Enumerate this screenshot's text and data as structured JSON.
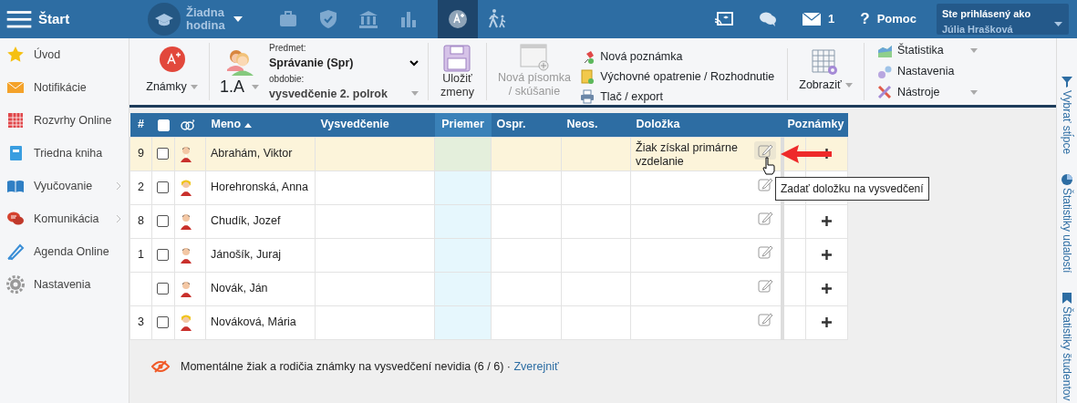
{
  "topbar": {
    "menu_label": "Štart",
    "lesson": "Žiadna hodina",
    "nav": [
      {
        "kind": "briefcase",
        "selected": false
      },
      {
        "kind": "shield",
        "selected": false
      },
      {
        "kind": "bank",
        "selected": false
      },
      {
        "kind": "chart",
        "selected": false
      },
      {
        "kind": "grade",
        "selected": true
      },
      {
        "kind": "walk",
        "selected": false
      }
    ],
    "mail_count": "1",
    "help_icon": "?",
    "help": "Pomoc",
    "user_label": "Ste prihlásený ako",
    "user_name": "Júlia Hrašková"
  },
  "sidebar": {
    "items": [
      {
        "label": "Úvod",
        "submenu": false
      },
      {
        "label": "Notifikácie",
        "submenu": false
      },
      {
        "label": "Rozvrhy Online",
        "submenu": false
      },
      {
        "label": "Triedna kniha",
        "submenu": false
      },
      {
        "label": "Vyučovanie",
        "submenu": true
      },
      {
        "label": "Komunikácia",
        "submenu": true
      },
      {
        "label": "Agenda Online",
        "submenu": false
      },
      {
        "label": "Nastavenia",
        "submenu": false
      }
    ]
  },
  "toolbar": {
    "grades": "Známky",
    "class": "1.A",
    "subject_label": "Predmet:",
    "subject": "Správanie (Spr)",
    "period_label": "obdobie:",
    "period": "vysvedčenie 2. polrok",
    "save": [
      "Uložiť",
      "zmeny"
    ],
    "new_test": {
      "lines": [
        "Nová písomka",
        "/ skúšanie"
      ],
      "disabled": true
    },
    "actions": [
      "Nová poznámka",
      "Výchovné opatrenie / Rozhodnutie",
      "Tlač / export"
    ],
    "view": "Zobraziť",
    "tools": [
      {
        "label": "Štatistika",
        "dropdown": true
      },
      {
        "label": "Nastavenia",
        "dropdown": false
      },
      {
        "label": "Nástroje",
        "dropdown": true
      }
    ]
  },
  "table": {
    "columns": [
      {
        "kind": "number",
        "label": "#"
      },
      {
        "kind": "select",
        "checked": false
      },
      {
        "kind": "gender"
      },
      {
        "kind": "name",
        "label": "Meno",
        "sorted": true
      },
      {
        "kind": "text",
        "label": "Vysvedčenie"
      },
      {
        "kind": "average",
        "label": "Priemer"
      },
      {
        "kind": "text",
        "label": "Ospr."
      },
      {
        "kind": "text",
        "label": "Neos."
      },
      {
        "kind": "clause",
        "label": "Doložka"
      },
      {
        "kind": "notes",
        "label": "Poznámky"
      }
    ],
    "rows": [
      {
        "number": "9",
        "checked": false,
        "kind": "boy",
        "name": "Abrahám, Viktor",
        "clause": "Žiak získal primárne vzdelanie",
        "highlighted": true
      },
      {
        "number": "2",
        "checked": false,
        "kind": "girl",
        "name": "Horehronská, Anna",
        "highlighted": false
      },
      {
        "number": "8",
        "checked": false,
        "kind": "boy",
        "name": "Chudík, Jozef",
        "highlighted": false
      },
      {
        "number": "1",
        "checked": false,
        "kind": "boy",
        "name": "Jánošík, Juraj",
        "highlighted": false
      },
      {
        "checked": false,
        "kind": "boy",
        "name": "Novák, Ján",
        "highlighted": false
      },
      {
        "number": "3",
        "checked": false,
        "kind": "girl",
        "name": "Nováková, Mária",
        "highlighted": false
      }
    ]
  },
  "tooltip": "Zadať doložku na vysvedčení",
  "notice": {
    "text": "Momentálne žiak a rodičia známky na vysvedčení nevidia (6 / 6) ·",
    "link": "Zverejniť"
  },
  "right_panel": [
    "Vybrať stĺpce",
    "Štatistiky udalostí",
    "Štatistiky študentov"
  ]
}
